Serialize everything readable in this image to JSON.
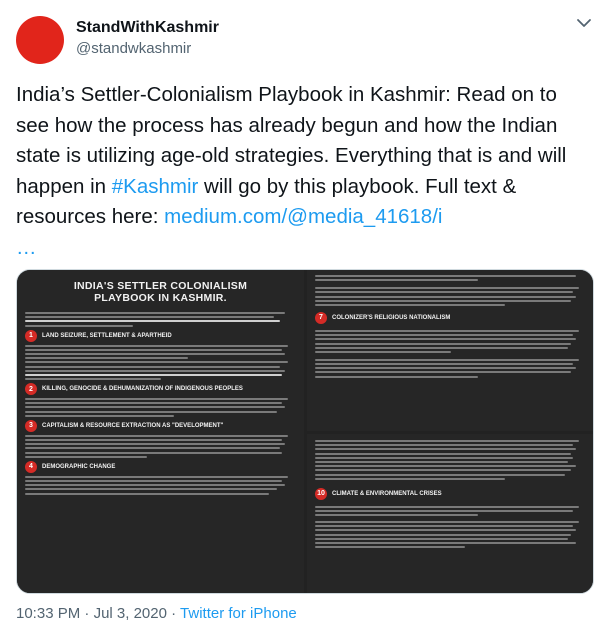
{
  "user": {
    "display_name": "StandWithKashmir",
    "handle": "@standwkashmir",
    "avatar_color": "#e1251b"
  },
  "tweet": {
    "text_before_hashtag": "India’s Settler-Colonialism Playbook in Kashmir: Read on to see how the process has already begun and how the Indian state is utilizing age-old strategies. Everything that is and will happen in ",
    "hashtag": "#Kashmir",
    "text_after_hashtag": " will go by this playbook. Full text & resources here: ",
    "link": "medium.com/@media_41618/i",
    "ellipsis": "…"
  },
  "media": {
    "title_line1": "INDIA'S SETTLER COLONIALISM",
    "title_line2": "PLAYBOOK IN KASHMIR.",
    "sections": [
      {
        "num": "1",
        "title": "LAND SEIZURE, SETTLEMENT & APARTHEID"
      },
      {
        "num": "2",
        "title": "KILLING, GENOCIDE & DEHUMANIZATION OF INDIGENOUS PEOPLES"
      },
      {
        "num": "3",
        "title": "CAPITALISM & RESOURCE EXTRACTION AS \"DEVELOPMENT\""
      },
      {
        "num": "4",
        "title": "DEMOGRAPHIC CHANGE"
      },
      {
        "num": "7",
        "title": "COLONIZER'S RELIGIOUS NATIONALISM"
      },
      {
        "num": "10",
        "title": "CLIMATE & ENVIRONMENTAL CRISES"
      }
    ],
    "accent_color": "#d42b26"
  },
  "meta": {
    "time": "10:33 PM",
    "separator": "·",
    "date": "Jul 3, 2020",
    "source": "Twitter for iPhone"
  },
  "colors": {
    "link": "#1d9bf0",
    "secondary_text": "#536471"
  },
  "icons": {
    "menu": "chevron-down-icon"
  }
}
